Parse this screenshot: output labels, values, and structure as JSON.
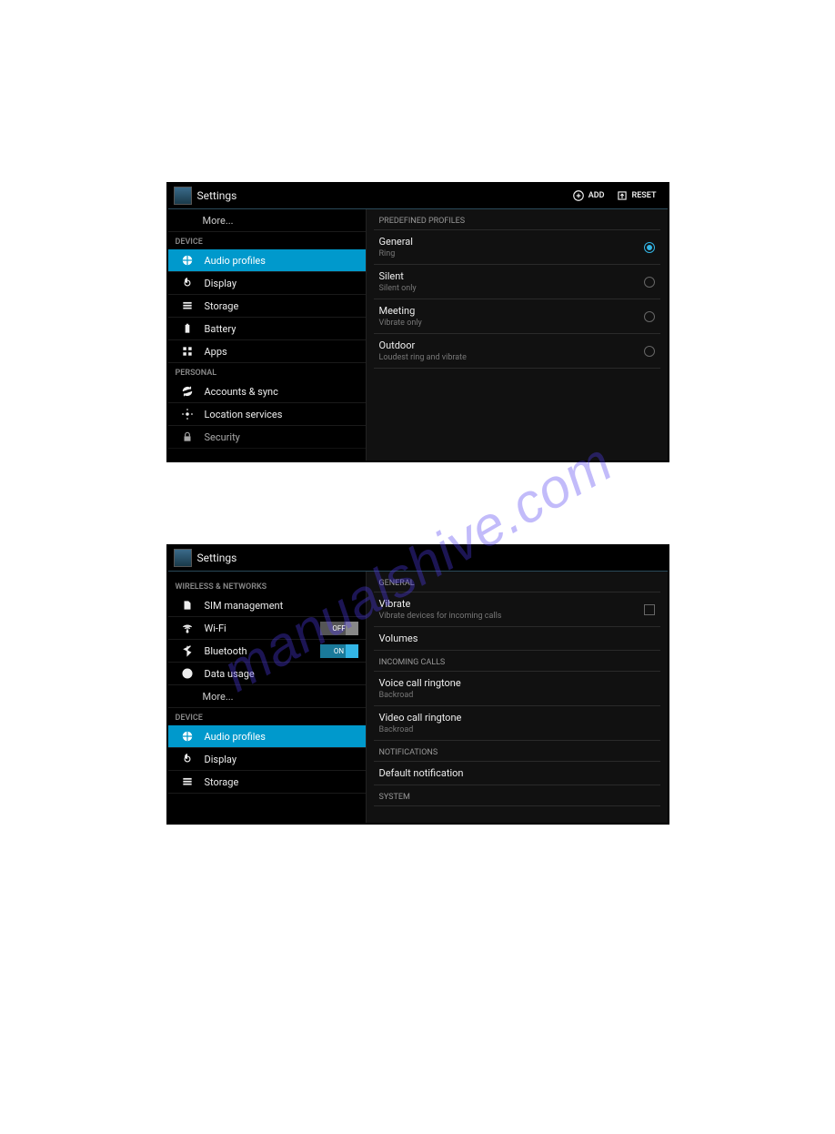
{
  "watermark": "manualshive.com",
  "screen1": {
    "header": {
      "title": "Settings",
      "add": "ADD",
      "reset": "RESET"
    },
    "sidebar": {
      "more": "More...",
      "device_header": "DEVICE",
      "items": [
        {
          "label": "Audio profiles"
        },
        {
          "label": "Display"
        },
        {
          "label": "Storage"
        },
        {
          "label": "Battery"
        },
        {
          "label": "Apps"
        }
      ],
      "personal_header": "PERSONAL",
      "personal_items": [
        {
          "label": "Accounts & sync"
        },
        {
          "label": "Location services"
        },
        {
          "label": "Security"
        }
      ]
    },
    "content": {
      "section": "PREDEFINED PROFILES",
      "rows": [
        {
          "title": "General",
          "sub": "Ring",
          "checked": true
        },
        {
          "title": "Silent",
          "sub": "Silent only",
          "checked": false
        },
        {
          "title": "Meeting",
          "sub": "Vibrate only",
          "checked": false
        },
        {
          "title": "Outdoor",
          "sub": "Loudest ring and vibrate",
          "checked": false
        }
      ]
    }
  },
  "screen2": {
    "header": {
      "title": "Settings"
    },
    "sidebar": {
      "wireless_header": "WIRELESS & NETWORKS",
      "wireless_items": [
        {
          "label": "SIM management"
        },
        {
          "label": "Wi-Fi",
          "toggle": "OFF"
        },
        {
          "label": "Bluetooth",
          "toggle": "ON"
        },
        {
          "label": "Data usage"
        }
      ],
      "more": "More...",
      "device_header": "DEVICE",
      "device_items": [
        {
          "label": "Audio profiles"
        },
        {
          "label": "Display"
        },
        {
          "label": "Storage"
        }
      ]
    },
    "content": {
      "sections": [
        {
          "header": "GENERAL",
          "rows": [
            {
              "title": "Vibrate",
              "sub": "Vibrate devices for incoming calls",
              "checkbox": true
            },
            {
              "title": "Volumes"
            }
          ]
        },
        {
          "header": "INCOMING CALLS",
          "rows": [
            {
              "title": "Voice call ringtone",
              "sub": "Backroad"
            },
            {
              "title": "Video call ringtone",
              "sub": "Backroad"
            }
          ]
        },
        {
          "header": "NOTIFICATIONS",
          "rows": [
            {
              "title": "Default notification"
            }
          ]
        },
        {
          "header": "SYSTEM",
          "rows": []
        }
      ]
    }
  }
}
